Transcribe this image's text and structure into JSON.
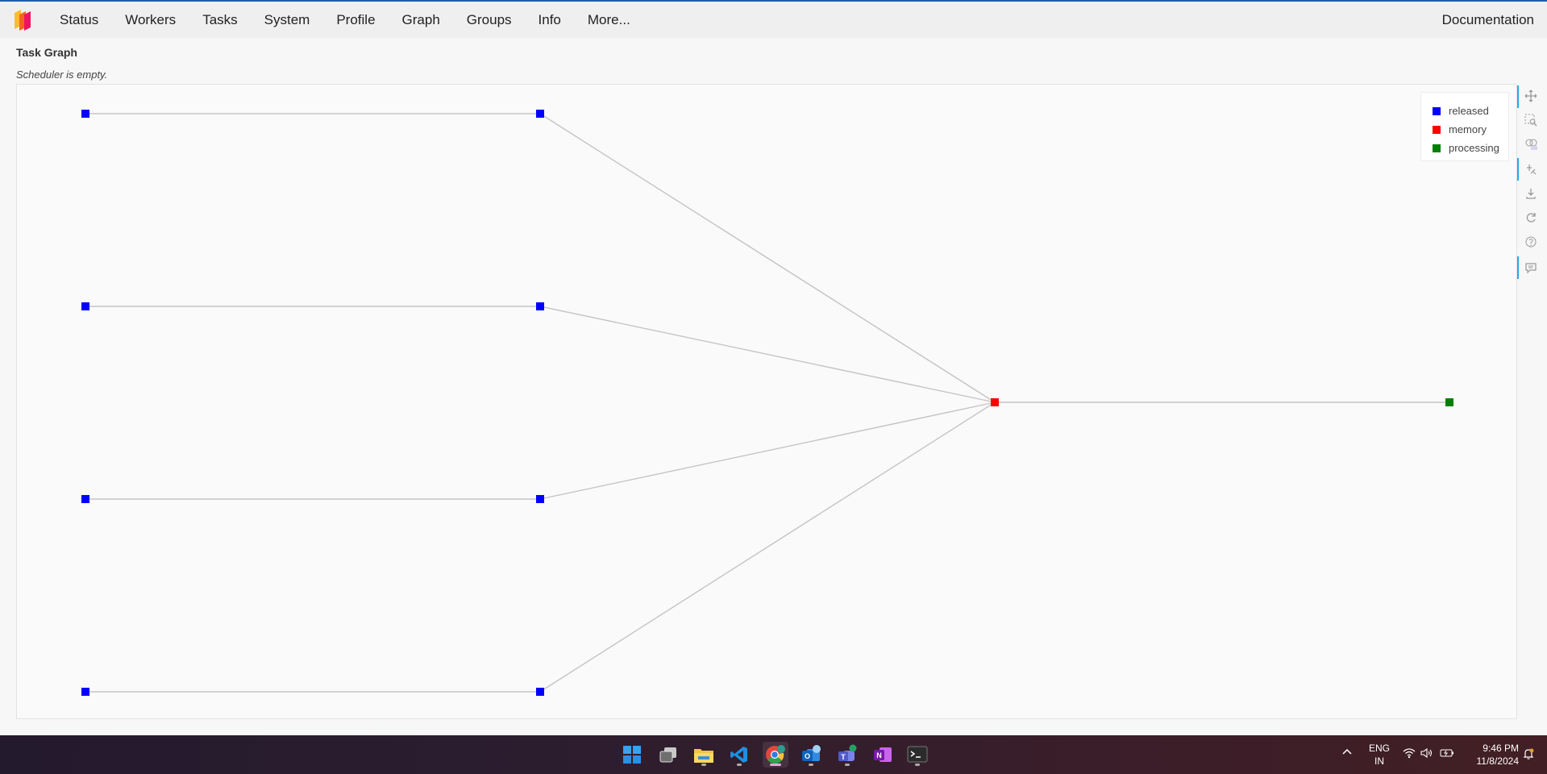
{
  "nav": {
    "items": [
      "Status",
      "Workers",
      "Tasks",
      "System",
      "Profile",
      "Graph",
      "Groups",
      "Info",
      "More..."
    ],
    "right_link": "Documentation"
  },
  "page": {
    "title": "Task Graph",
    "status": "Scheduler is empty."
  },
  "legend": [
    {
      "label": "released",
      "color": "#0000ff"
    },
    {
      "label": "memory",
      "color": "#ff0000"
    },
    {
      "label": "processing",
      "color": "#007f00"
    }
  ],
  "toolbar": [
    "pan-icon",
    "box-zoom-icon",
    "wheel-zoom-icon",
    "tap-icon",
    "save-icon",
    "reset-icon",
    "help-icon",
    "hover-icon"
  ],
  "taskbar": {
    "apps": [
      "windows-start-icon",
      "task-view-icon",
      "file-explorer-icon",
      "vscode-icon",
      "chrome-icon",
      "outlook-icon",
      "teams-icon",
      "onenote-icon",
      "terminal-icon"
    ],
    "language": "ENG",
    "region": "IN",
    "time": "9:46 PM",
    "date": "11/8/2024"
  },
  "colors": {
    "released": "#0000ff",
    "memory": "#ff0000",
    "processing": "#007f00",
    "edge": "#c4c4c4",
    "nav_top_border": "#1f5fa8"
  }
}
